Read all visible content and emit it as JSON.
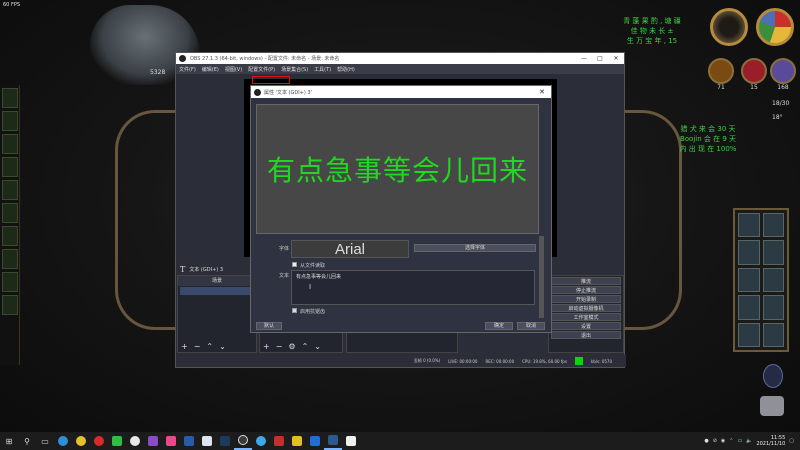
{
  "game": {
    "fps": "60 FPS",
    "number_label": "5328",
    "top_right_text": [
      "青 蓬 果 酌 , 塘 疆",
      "佳 物 未 长 ±",
      "生 万 宝 年 , 15"
    ],
    "right_text": [
      "猎 犬 来 会 30 天",
      "Boojin 会 在 9 天",
      "内 出 现 在 100%"
    ],
    "stat_values": [
      "71",
      "15",
      "168"
    ],
    "side_values": [
      "18/30",
      "18°"
    ]
  },
  "obs": {
    "title": "OBS 27.1.3 (64-bit, windows) - 配置文件: 未命名 - 场景: 未命名",
    "menu": [
      "文件(F)",
      "编辑(E)",
      "视图(V)",
      "配置文件(P)",
      "场景集合(S)",
      "工具(T)",
      "帮助(H)"
    ],
    "source_bar": "文本 (GDI+) 3",
    "scenes_header": "场景",
    "controls": [
      "推流",
      "停止推流",
      "开始录制",
      "启动虚拟摄像机",
      "工作室模式",
      "设置",
      "退出"
    ],
    "status": [
      "丢帧 0 (0.0%)",
      "LIVE: 00:00:00",
      "REC: 00:00:00",
      "CPU: 19.8%, 60.00 fps",
      "kb/s: 0570"
    ]
  },
  "dialog": {
    "title": "属性 '文本 (GDI+) 3'",
    "preview_text": "有点急事等会儿回来",
    "font_label": "字体",
    "font_name": "Arial",
    "select_font_button": "选择字体",
    "from_file_label": "从文件读取",
    "text_label": "文本",
    "text_value": "有点急事等会儿回来",
    "antialias_label": "启用抗锯齿",
    "defaults_button": "默认",
    "ok_button": "确定",
    "cancel_button": "取消",
    "preview_color": "#1fd81f"
  },
  "taskbar": {
    "time": "11:55",
    "date": "2021/11/10",
    "apps": [
      "start",
      "search",
      "task-view",
      "edge",
      "chrome",
      "netease-music",
      "wechat",
      "qq-music",
      "contacts",
      "steam-folder",
      "steam",
      "obs",
      "wegame",
      "steam-active",
      "notepad"
    ]
  }
}
